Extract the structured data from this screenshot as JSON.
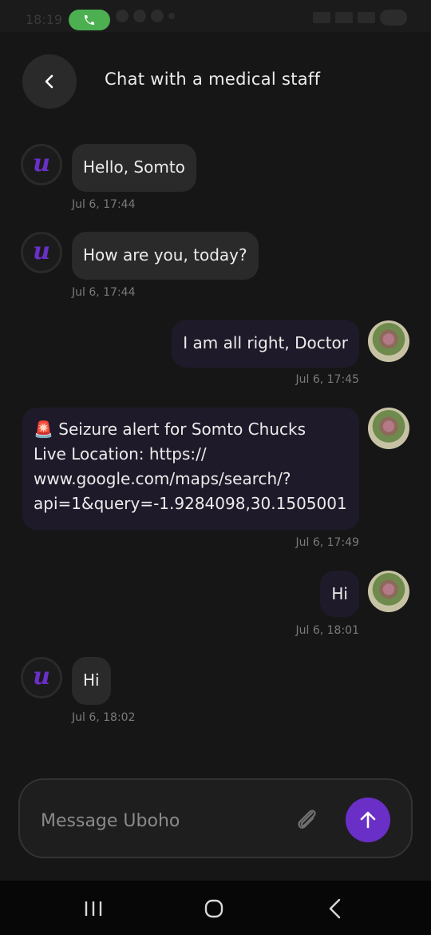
{
  "status_bar": {
    "time": "18:19",
    "icons": [
      "phone-call-icon",
      "snapchat-icon",
      "whatsapp-icon",
      "snapchat-icon",
      "location-icon",
      "wifi-icon",
      "signal-icon",
      "battery-icon"
    ]
  },
  "header": {
    "title": "Chat with a medical staff",
    "back_icon": "chevron-left-icon"
  },
  "messages": [
    {
      "sender": "bot",
      "avatar_letter": "u",
      "text": "Hello, Somto",
      "timestamp": "Jul 6, 17:44"
    },
    {
      "sender": "bot",
      "avatar_letter": "u",
      "text": "How are you, today?",
      "timestamp": "Jul 6, 17:44"
    },
    {
      "sender": "user",
      "text": "I am all right, Doctor",
      "timestamp": "Jul 6, 17:45"
    },
    {
      "sender": "user",
      "lines": [
        "🚨 Seizure alert for Somto Chucks",
        "Live Location: https://",
        "www.google.com/maps/search/?",
        "api=1&query=-1.9284098,30.1505001"
      ],
      "timestamp": "Jul 6, 17:49"
    },
    {
      "sender": "user",
      "text": "Hi",
      "timestamp": "Jul 6, 18:01"
    },
    {
      "sender": "bot",
      "avatar_letter": "u",
      "text": "Hi",
      "timestamp": "Jul 6, 18:02"
    }
  ],
  "composer": {
    "placeholder": "Message Uboho",
    "attach_icon": "paperclip-icon",
    "send_icon": "arrow-up-icon"
  },
  "nav_bar": {
    "icons": [
      "recent-apps-icon",
      "home-icon",
      "back-icon"
    ]
  },
  "colors": {
    "background": "#161616",
    "accent": "#6a2fc7",
    "incoming_bubble": "#2a2a2a",
    "outgoing_bubble": "#1f1a29",
    "call_pill": "#4caf50"
  }
}
